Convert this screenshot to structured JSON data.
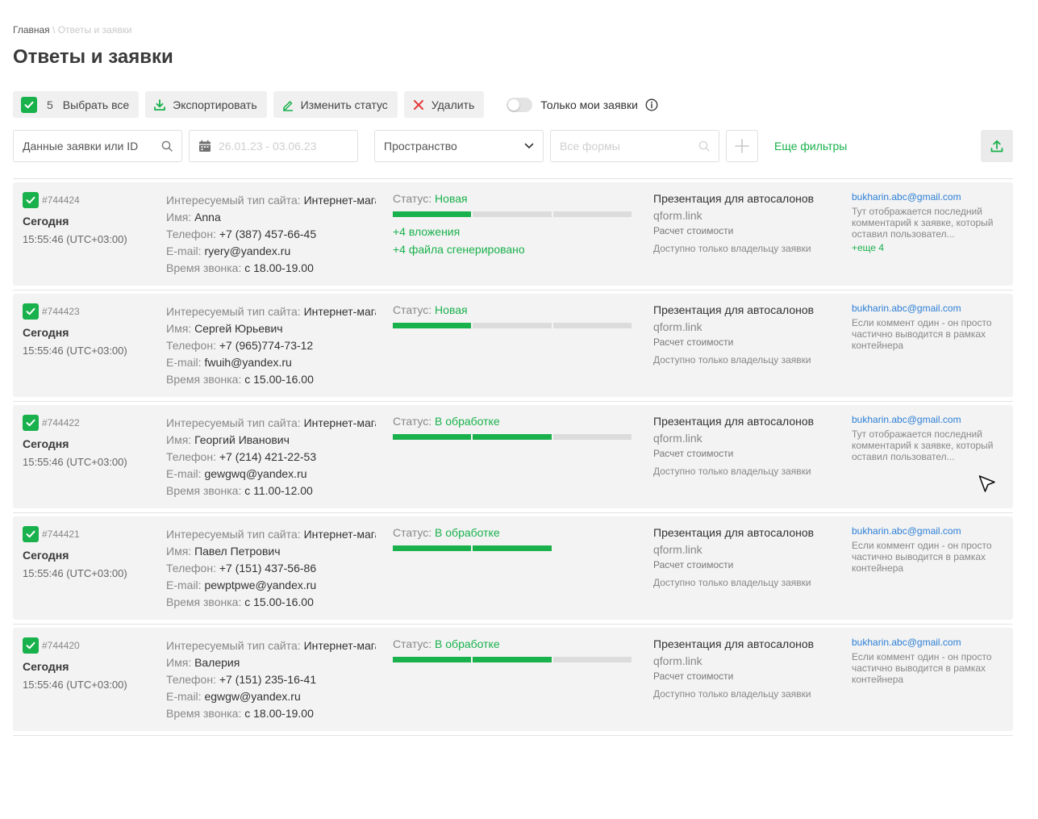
{
  "breadcrumb": {
    "home": "Главная",
    "separator": " \\ ",
    "current": "Ответы и заявки"
  },
  "page_title": "Ответы и заявки",
  "toolbar": {
    "selected_count": "5",
    "select_all": "Выбрать все",
    "export": "Экспортировать",
    "change_status": "Изменить статус",
    "delete": "Удалить",
    "only_mine": "Только мои заявки"
  },
  "filters": {
    "search_placeholder": "Данные заявки или ID",
    "date_placeholder": "26.01.23 - 03.06.23",
    "space": "Пространство",
    "forms_placeholder": "Все формы",
    "more_filters": "Еще фильтры"
  },
  "labels": {
    "site_type": "Интересуемый тип сайта: ",
    "name": "Имя: ",
    "phone": "Телефон: ",
    "email": "E-mail: ",
    "call_time": "Время звонка: ",
    "status": "Статус: "
  },
  "colors": {
    "accent": "#19b14c",
    "link": "#2d7fd6",
    "row_bg": "#f3f3f3"
  },
  "rows": [
    {
      "id": "#744424",
      "day": "Сегодня",
      "time": "15:55:46 (UTC+03:00)",
      "site_type": "Интернет-магазин",
      "name": "Anna",
      "phone": "+7 (387) 457-66-45",
      "email": "ryery@yandex.ru",
      "call_time": "с 18.00-19.00",
      "status": "Новая",
      "progress": 1,
      "segments": 3,
      "attachments": "+4 вложения",
      "generated": "+4 файла сгенерировано",
      "form_title": "Презентация для автосалонов",
      "domain": "qform.link",
      "calc": "Расчет стоимости",
      "access": "Доступно только владельцу заявки",
      "author_email": "bukharin.abc@gmail.com",
      "comment": "Тут отображается последний комментарий к заявке, который оставил пользовател...",
      "more": "+еще 4"
    },
    {
      "id": "#744423",
      "day": "Сегодня",
      "time": "15:55:46 (UTC+03:00)",
      "site_type": "Интернет-магазин",
      "name": "Сергей Юрьевич",
      "phone": "+7 (965)774-73-12",
      "email": "fwuih@yandex.ru",
      "call_time": "с 15.00-16.00",
      "status": "Новая",
      "progress": 1,
      "segments": 3,
      "form_title": "Презентация для автосалонов",
      "domain": "qform.link",
      "calc": "Расчет стоимости",
      "access": "Доступно только владельцу заявки",
      "author_email": "bukharin.abc@gmail.com",
      "comment": "Если коммент один - он просто частично выводится в рамках контейнера"
    },
    {
      "id": "#744422",
      "day": "Сегодня",
      "time": "15:55:46 (UTC+03:00)",
      "site_type": "Интернет-магазин",
      "name": "Георгий Иванович",
      "phone": "+7 (214) 421-22-53",
      "email": "gewgwq@yandex.ru",
      "call_time": "с 11.00-12.00",
      "status": "В обработке",
      "progress": 2,
      "segments": 3,
      "form_title": "Презентация для автосалонов",
      "domain": "qform.link",
      "calc": "Расчет стоимости",
      "access": "Доступно только владельцу заявки",
      "author_email": "bukharin.abc@gmail.com",
      "comment": "Тут отображается последний комментарий к заявке, который оставил пользовател..."
    },
    {
      "id": "#744421",
      "day": "Сегодня",
      "time": "15:55:46 (UTC+03:00)",
      "site_type": "Интернет-магазин",
      "name": "Павел Петрович",
      "phone": "+7 (151) 437-56-86",
      "email": "pewptpwe@yandex.ru",
      "call_time": "с 15.00-16.00",
      "status": "В обработке",
      "progress": 2,
      "segments": 2,
      "form_title": "Презентация для автосалонов",
      "domain": "qform.link",
      "calc": "Расчет стоимости",
      "access": "Доступно только владельцу заявки",
      "author_email": "bukharin.abc@gmail.com",
      "comment": "Если коммент один - он просто частично выводится в рамках контейнера"
    },
    {
      "id": "#744420",
      "day": "Сегодня",
      "time": "15:55:46 (UTC+03:00)",
      "site_type": "Интернет-магазин",
      "name": "Валерия",
      "phone": "+7 (151) 235-16-41",
      "email": "egwgw@yandex.ru",
      "call_time": "с 18.00-19.00",
      "status": "В обработке",
      "progress": 2,
      "segments": 3,
      "form_title": "Презентация для автосалонов",
      "domain": "qform.link",
      "calc": "Расчет стоимости",
      "access": "Доступно только владельцу заявки",
      "author_email": "bukharin.abc@gmail.com",
      "comment": "Если коммент один - он просто частично выводится в рамках контейнера"
    }
  ]
}
